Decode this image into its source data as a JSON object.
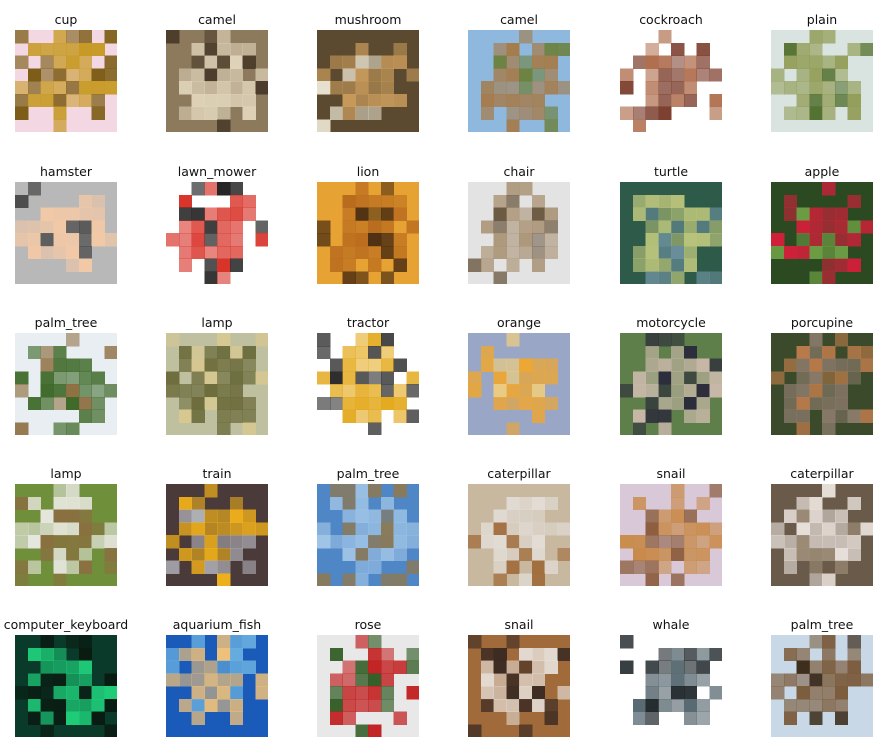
{
  "rows": [
    [
      {
        "label": "cup",
        "icon": "cup-photo",
        "colors": [
          "#f3d7e2",
          "#c79a27",
          "#7a5a12"
        ]
      },
      {
        "label": "camel",
        "icon": "camel-photo",
        "colors": [
          "#8d7a5d",
          "#e1d5bb",
          "#4a3b2a"
        ]
      },
      {
        "label": "mushroom",
        "icon": "mushroom-photo",
        "colors": [
          "#5b4a2f",
          "#c79a5c",
          "#e9e2d0"
        ]
      },
      {
        "label": "camel",
        "icon": "camel-photo",
        "colors": [
          "#8fb8de",
          "#a57b4a",
          "#6b7f3a"
        ]
      },
      {
        "label": "cockroach",
        "icon": "cockroach-photo",
        "colors": [
          "#ffffff",
          "#7a3b2a",
          "#b07050"
        ]
      },
      {
        "label": "plain",
        "icon": "plain-photo",
        "colors": [
          "#d9e4e0",
          "#8f9a52",
          "#4f6d2b"
        ]
      }
    ],
    [
      {
        "label": "hamster",
        "icon": "hamster-photo",
        "colors": [
          "#b8b8b8",
          "#f3c9a6",
          "#3a3a3a"
        ]
      },
      {
        "label": "lawn_mower",
        "icon": "lawn-mower-photo",
        "colors": [
          "#ffffff",
          "#d8342a",
          "#222222"
        ]
      },
      {
        "label": "lion",
        "icon": "lion-photo",
        "colors": [
          "#e6a232",
          "#b96c1e",
          "#4a2d12"
        ]
      },
      {
        "label": "chair",
        "icon": "chair-photo",
        "colors": [
          "#e3e3e3",
          "#a99274",
          "#6a5840"
        ]
      },
      {
        "label": "turtle",
        "icon": "turtle-photo",
        "colors": [
          "#2e5a4a",
          "#b7c27a",
          "#6a8f9a"
        ]
      },
      {
        "label": "apple",
        "icon": "apple-photo",
        "colors": [
          "#2c4a22",
          "#d41f3a",
          "#6fa046"
        ]
      }
    ],
    [
      {
        "label": "palm_tree",
        "icon": "palm-tree-photo",
        "colors": [
          "#e8eef2",
          "#3f6a2a",
          "#8a6a3a"
        ]
      },
      {
        "label": "lamp",
        "icon": "lamp-photo",
        "colors": [
          "#bfc0a0",
          "#6a6a3a",
          "#d8c890"
        ]
      },
      {
        "label": "tractor",
        "icon": "tractor-photo",
        "colors": [
          "#ffffff",
          "#e3a81a",
          "#2a2a2a"
        ]
      },
      {
        "label": "orange",
        "icon": "orange-photo",
        "colors": [
          "#9aa6c6",
          "#f2a72a",
          "#f6d27a"
        ]
      },
      {
        "label": "motorcycle",
        "icon": "motorcycle-photo",
        "colors": [
          "#5f7f4a",
          "#c8b8a8",
          "#2a2a3a"
        ]
      },
      {
        "label": "porcupine",
        "icon": "porcupine-photo",
        "colors": [
          "#3a4a2a",
          "#8a7a6a",
          "#b87a4a"
        ]
      }
    ],
    [
      {
        "label": "lamp",
        "icon": "lamp-photo",
        "colors": [
          "#6f8f3a",
          "#e8e8e0",
          "#8a7040"
        ]
      },
      {
        "label": "train",
        "icon": "train-photo",
        "colors": [
          "#4a3a3a",
          "#f2b21a",
          "#b0b0b8"
        ]
      },
      {
        "label": "palm_tree",
        "icon": "palm-tree-photo",
        "colors": [
          "#4f86c6",
          "#9fc4e6",
          "#8a7a5a"
        ]
      },
      {
        "label": "caterpillar",
        "icon": "caterpillar-photo",
        "colors": [
          "#c8b8a0",
          "#e2ddd6",
          "#a06a3a"
        ]
      },
      {
        "label": "snail",
        "icon": "snail-photo",
        "colors": [
          "#d8c8d8",
          "#c88a4a",
          "#8a5a3a"
        ]
      },
      {
        "label": "caterpillar",
        "icon": "caterpillar-photo",
        "colors": [
          "#6a5a4a",
          "#e8e0da",
          "#a0907a"
        ]
      }
    ],
    [
      {
        "label": "computer_keyboard",
        "icon": "keyboard-photo",
        "colors": [
          "#0a3a2a",
          "#1fcf7a",
          "#0a1a12"
        ]
      },
      {
        "label": "aquarium_fish",
        "icon": "aquarium-fish-photo",
        "colors": [
          "#1a5ab8",
          "#f2c27a",
          "#6ab0e0"
        ]
      },
      {
        "label": "rose",
        "icon": "rose-photo",
        "colors": [
          "#e8e8e8",
          "#c01a1a",
          "#2f5a22"
        ]
      },
      {
        "label": "snail",
        "icon": "snail-photo",
        "colors": [
          "#a06a3a",
          "#e8e2dc",
          "#3a2a22"
        ]
      },
      {
        "label": "whale",
        "icon": "whale-photo",
        "colors": [
          "#ffffff",
          "#5a6a72",
          "#1a2226"
        ]
      },
      {
        "label": "palm_tree",
        "icon": "palm-tree-photo",
        "colors": [
          "#c8d8e6",
          "#7a5a3a",
          "#3a2a1a"
        ]
      }
    ]
  ]
}
